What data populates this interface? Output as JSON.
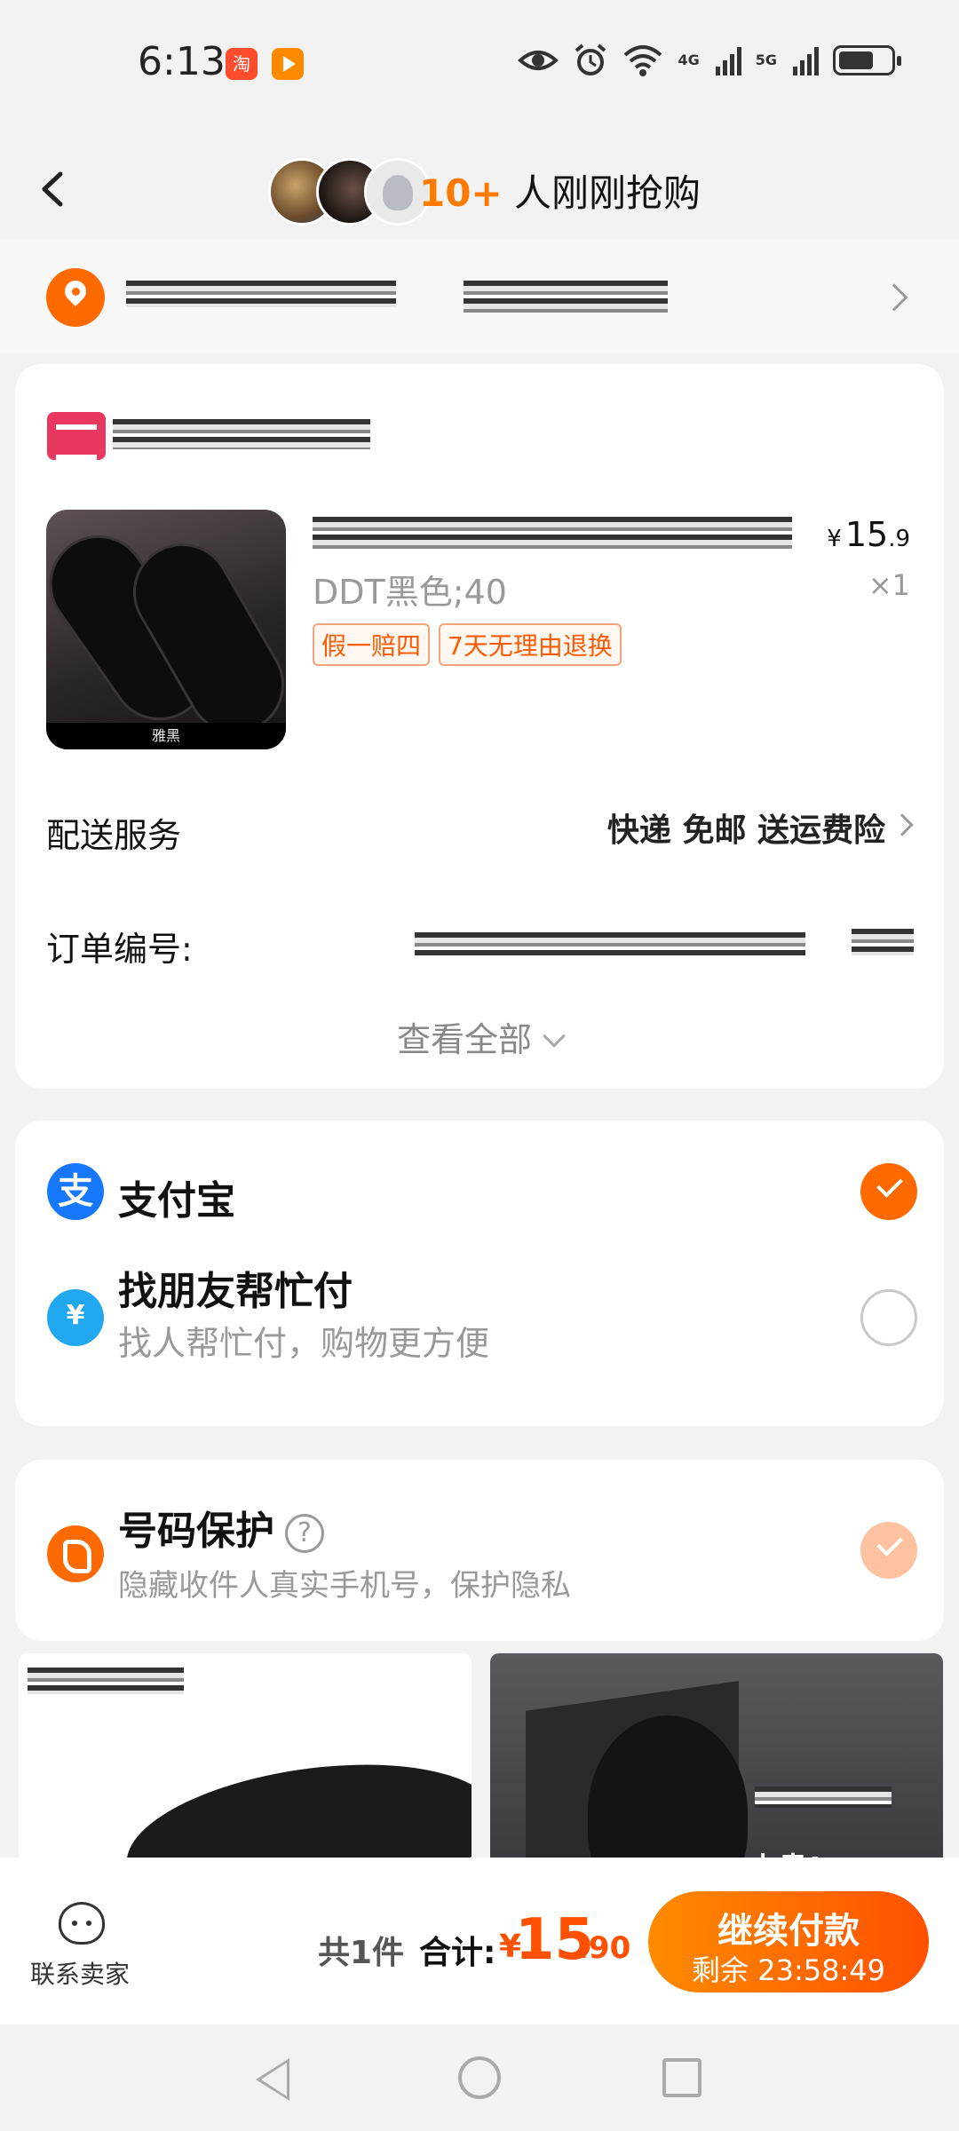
{
  "status_bar": {
    "time": "6:13",
    "app_badge": "淘",
    "network1": "4G",
    "network2": "5G"
  },
  "header": {
    "buyer_count": "10+",
    "buyer_text": "人刚刚抢购"
  },
  "order": {
    "sku": "DDT黑色;40",
    "price_int": "15",
    "price_dec": ".9",
    "currency": "¥",
    "quantity": "×1",
    "tags": [
      "假一赔四",
      "7天无理由退换"
    ],
    "image_caption": "雅黑",
    "delivery_label": "配送服务",
    "delivery_value": "快递 免邮 送运费险",
    "order_no_label": "订单编号:",
    "see_all": "查看全部"
  },
  "payment": {
    "alipay_icon": "支",
    "alipay_label": "支付宝",
    "friend_icon": "¥",
    "friend_label": "找朋友帮忙付",
    "friend_sub": "找人帮忙付，购物更方便"
  },
  "protection": {
    "title": "号码保护",
    "help": "?",
    "subtitle": "隐藏收件人真实手机号，保护隐私"
  },
  "recommendation": {
    "tile2_text": "小贵!"
  },
  "bottom": {
    "contact_label": "联系卖家",
    "item_count": "共1件",
    "total_label": "合计:",
    "currency": "¥",
    "total_int": "15",
    "total_dec": ".90",
    "pay_button": "继续付款",
    "countdown": "剩余 23:58:49"
  },
  "colors": {
    "accent": "#ff6a00",
    "price": "#ff5000",
    "alipay": "#1677ff"
  }
}
